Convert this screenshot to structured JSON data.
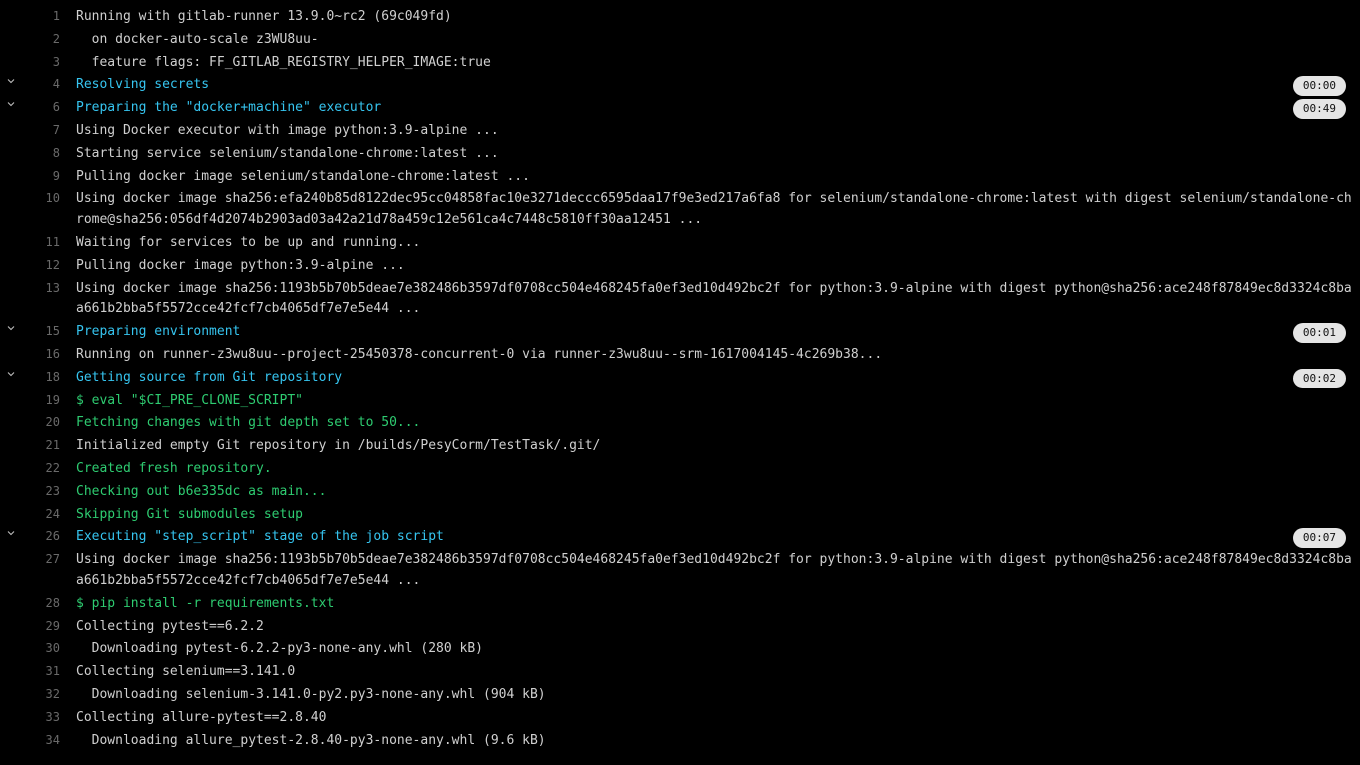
{
  "lines": [
    {
      "n": 1,
      "text": "Running with gitlab-runner 13.9.0~rc2 (69c049fd)"
    },
    {
      "n": 2,
      "text": "  on docker-auto-scale z3WU8uu-"
    },
    {
      "n": 3,
      "text": "  feature flags: FF_GITLAB_REGISTRY_HELPER_IMAGE:true"
    },
    {
      "n": 4,
      "text": "Resolving secrets",
      "style": "cyan",
      "collapsible": true,
      "badge": "00:00"
    },
    {
      "n": 6,
      "text": "Preparing the \"docker+machine\" executor",
      "style": "cyan",
      "collapsible": true,
      "badge": "00:49"
    },
    {
      "n": 7,
      "text": "Using Docker executor with image python:3.9-alpine ..."
    },
    {
      "n": 8,
      "text": "Starting service selenium/standalone-chrome:latest ..."
    },
    {
      "n": 9,
      "text": "Pulling docker image selenium/standalone-chrome:latest ..."
    },
    {
      "n": 10,
      "text": "Using docker image sha256:efa240b85d8122dec95cc04858fac10e3271deccc6595daa17f9e3ed217a6fa8 for selenium/standalone-chrome:latest with digest selenium/standalone-chrome@sha256:056df4d2074b2903ad03a42a21d78a459c12e561ca4c7448c5810ff30aa12451 ..."
    },
    {
      "n": 11,
      "text": "Waiting for services to be up and running..."
    },
    {
      "n": 12,
      "text": "Pulling docker image python:3.9-alpine ..."
    },
    {
      "n": 13,
      "text": "Using docker image sha256:1193b5b70b5deae7e382486b3597df0708cc504e468245fa0ef3ed10d492bc2f for python:3.9-alpine with digest python@sha256:ace248f87849ec8d3324c8baa661b2bba5f5572cce42fcf7cb4065df7e7e5e44 ..."
    },
    {
      "n": 15,
      "text": "Preparing environment",
      "style": "cyan",
      "collapsible": true,
      "badge": "00:01"
    },
    {
      "n": 16,
      "text": "Running on runner-z3wu8uu--project-25450378-concurrent-0 via runner-z3wu8uu--srm-1617004145-4c269b38..."
    },
    {
      "n": 18,
      "text": "Getting source from Git repository",
      "style": "cyan",
      "collapsible": true,
      "badge": "00:02"
    },
    {
      "n": 19,
      "text": "$ eval \"$CI_PRE_CLONE_SCRIPT\"",
      "style": "green"
    },
    {
      "n": 20,
      "text": "Fetching changes with git depth set to 50...",
      "style": "green"
    },
    {
      "n": 21,
      "text": "Initialized empty Git repository in /builds/PesyCorm/TestTask/.git/"
    },
    {
      "n": 22,
      "text": "Created fresh repository.",
      "style": "green"
    },
    {
      "n": 23,
      "text": "Checking out b6e335dc as main...",
      "style": "green"
    },
    {
      "n": 24,
      "text": "Skipping Git submodules setup",
      "style": "green"
    },
    {
      "n": 26,
      "text": "Executing \"step_script\" stage of the job script",
      "style": "cyan",
      "collapsible": true,
      "badge": "00:07"
    },
    {
      "n": 27,
      "text": "Using docker image sha256:1193b5b70b5deae7e382486b3597df0708cc504e468245fa0ef3ed10d492bc2f for python:3.9-alpine with digest python@sha256:ace248f87849ec8d3324c8baa661b2bba5f5572cce42fcf7cb4065df7e7e5e44 ..."
    },
    {
      "n": 28,
      "text": "$ pip install -r requirements.txt",
      "style": "green"
    },
    {
      "n": 29,
      "text": "Collecting pytest==6.2.2"
    },
    {
      "n": 30,
      "text": "  Downloading pytest-6.2.2-py3-none-any.whl (280 kB)"
    },
    {
      "n": 31,
      "text": "Collecting selenium==3.141.0"
    },
    {
      "n": 32,
      "text": "  Downloading selenium-3.141.0-py2.py3-none-any.whl (904 kB)"
    },
    {
      "n": 33,
      "text": "Collecting allure-pytest==2.8.40"
    },
    {
      "n": 34,
      "text": "  Downloading allure_pytest-2.8.40-py3-none-any.whl (9.6 kB)"
    }
  ]
}
